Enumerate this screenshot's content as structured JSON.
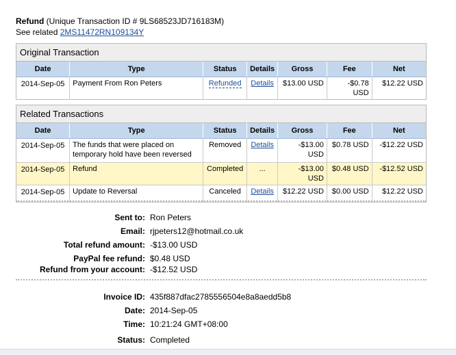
{
  "header": {
    "title": "Refund",
    "txn_id_text": "(Unique Transaction ID # 9LS68523JD716183M)",
    "see_related_label": "See related",
    "related_link": "2MS11472RN109134Y"
  },
  "original": {
    "title": "Original Transaction",
    "columns": [
      "Date",
      "Type",
      "Status",
      "Details",
      "Gross",
      "Fee",
      "Net"
    ],
    "rows": [
      {
        "date": "2014-Sep-05",
        "type": "Payment From Ron Peters",
        "status": "Refunded",
        "details": "Details",
        "gross": "$13.00 USD",
        "fee": "-$0.78 USD",
        "net": "$12.22 USD"
      }
    ]
  },
  "related": {
    "title": "Related Transactions",
    "columns": [
      "Date",
      "Type",
      "Status",
      "Details",
      "Gross",
      "Fee",
      "Net"
    ],
    "rows": [
      {
        "date": "2014-Sep-05",
        "type": "The funds that were placed on temporary hold have been reversed",
        "status": "Removed",
        "details": "Details",
        "gross": "-$13.00 USD",
        "fee": "$0.78 USD",
        "net": "-$12.22 USD"
      },
      {
        "date": "2014-Sep-05",
        "type": "Refund",
        "status": "Completed",
        "details": "...",
        "gross": "-$13.00 USD",
        "fee": "$0.48 USD",
        "net": "-$12.52 USD"
      },
      {
        "date": "2014-Sep-05",
        "type": "Update to Reversal",
        "status": "Canceled",
        "details": "Details",
        "gross": "$12.22 USD",
        "fee": "$0.00 USD",
        "net": "$12.22 USD"
      }
    ]
  },
  "summary": {
    "sent_to_label": "Sent to:",
    "sent_to": "Ron Peters",
    "email_label": "Email:",
    "email": "rjpeters12@hotmail.co.uk",
    "total_refund_label": "Total refund amount:",
    "total_refund": "-$13.00 USD",
    "fee_refund_label": "PayPal fee refund:",
    "fee_refund": "$0.48 USD",
    "refund_account_label": "Refund from your account:",
    "refund_account": "-$12.52 USD"
  },
  "invoice": {
    "invoice_id_label": "Invoice ID:",
    "invoice_id": "435f887dfac2785556504e8a8aedd5b8",
    "date_label": "Date:",
    "date": "2014-Sep-05",
    "time_label": "Time:",
    "time": "10:21:24 GMT+08:00",
    "status_label": "Status:",
    "status": "Completed"
  },
  "colors": {
    "link": "#1a4e97",
    "header_row": "#c4d7ec",
    "highlight_row": "#fff7c8",
    "panel_title_bg": "#eeeeee"
  }
}
